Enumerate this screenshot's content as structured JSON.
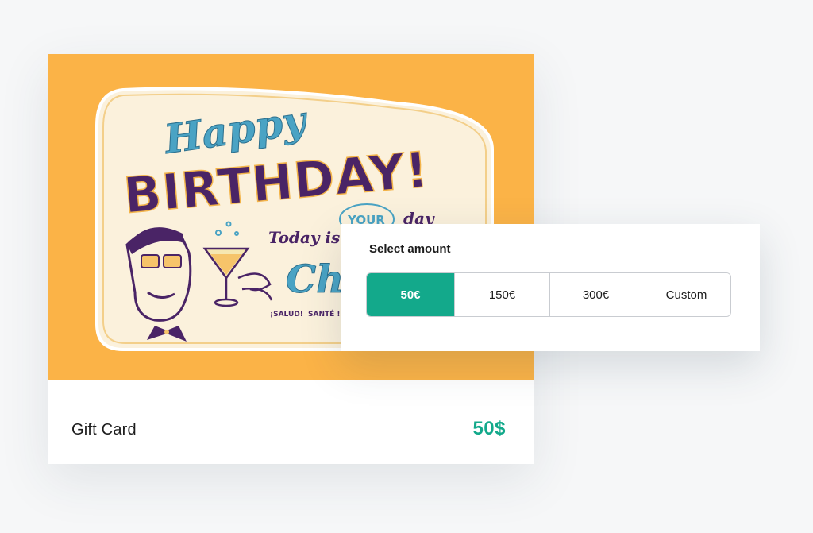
{
  "product": {
    "name": "Gift Card",
    "price": "50$",
    "image": {
      "line1": "Happy",
      "line2": "BIRTHDAY!",
      "line3_a": "Today is",
      "line3_b": "YOUR",
      "line3_c": "day",
      "line4": "Che",
      "footer_a": "¡SALUD!",
      "footer_b": "SANTÉ !"
    }
  },
  "amount_selector": {
    "label": "Select amount",
    "options": [
      "50€",
      "150€",
      "300€",
      "Custom"
    ],
    "selected": "50€"
  },
  "colors": {
    "accent": "#13a98b",
    "card_background": "#fbb347",
    "ink_purple": "#4a2466",
    "ink_blue": "#4aa3c4",
    "cream": "#fbf1dc"
  }
}
